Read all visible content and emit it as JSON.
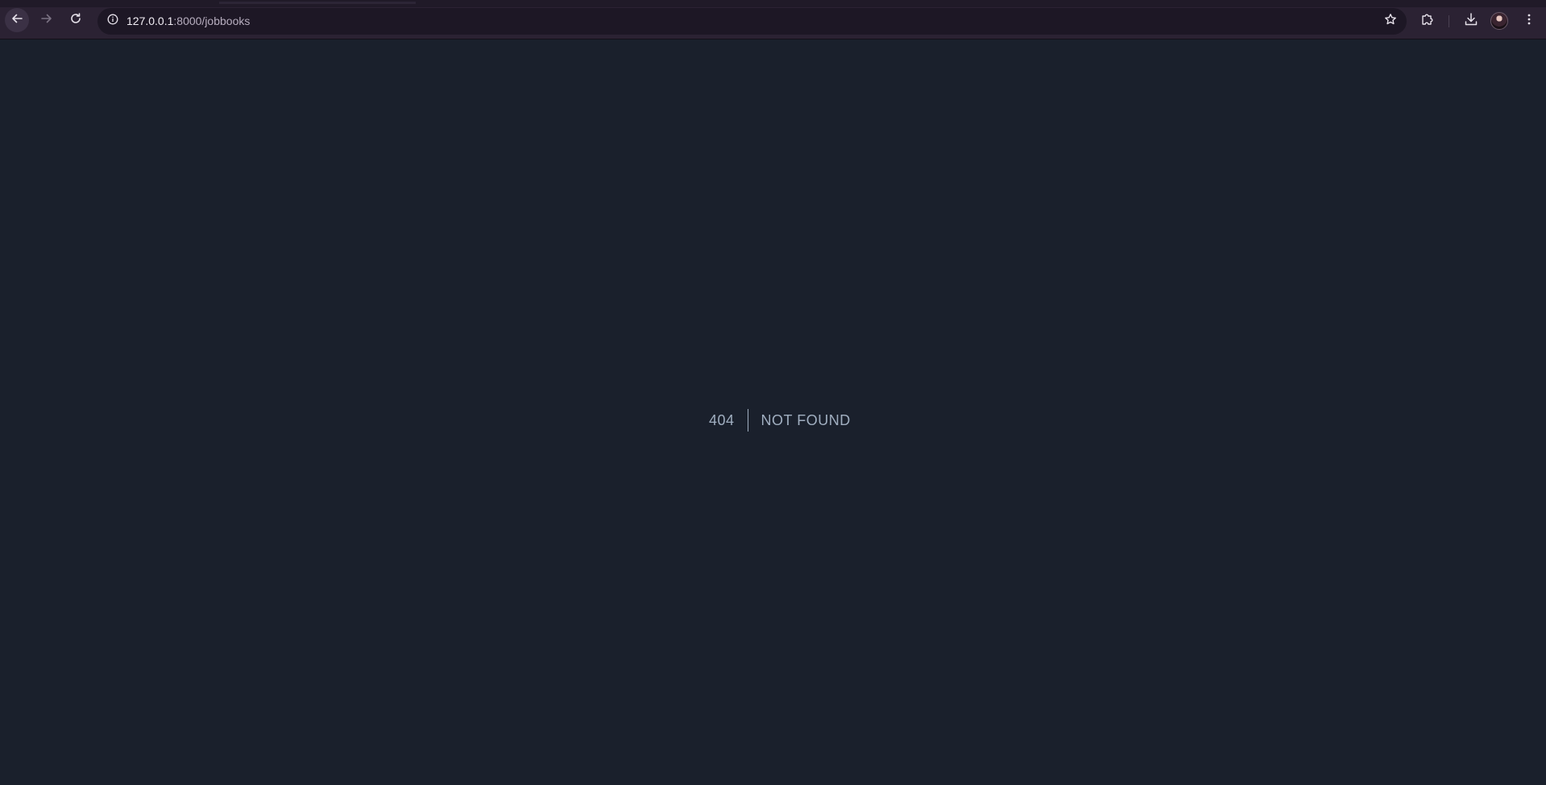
{
  "browser": {
    "address_bar": {
      "host": "127.0.0.1",
      "path": ":8000/jobbooks"
    },
    "icons": {
      "back": "arrow-left-icon",
      "forward": "arrow-right-icon",
      "reload": "reload-icon",
      "site_info": "info-icon",
      "bookmark": "star-icon",
      "extensions": "puzzle-icon",
      "downloads": "download-icon",
      "menu": "kebab-menu-icon"
    },
    "colors": {
      "toolbar": "#2b2233",
      "omnibox": "#1d1725",
      "page_background": "#1a202c"
    }
  },
  "page": {
    "status_code": "404",
    "status_message": "NOT FOUND",
    "text_color": "#a0aec0"
  }
}
